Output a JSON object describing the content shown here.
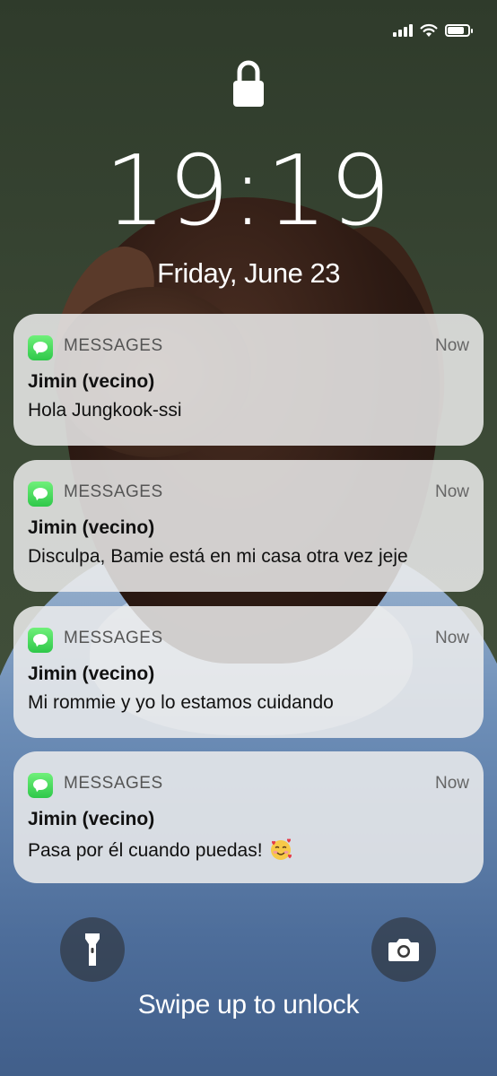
{
  "status_bar": {
    "signal_icon": "cellular-signal-icon",
    "wifi_icon": "wifi-icon",
    "battery_icon": "battery-icon",
    "battery_level": 0.85
  },
  "lock_screen": {
    "lock_icon": "padlock-icon",
    "time": "19:19",
    "date": "Friday, June 23"
  },
  "notifications": [
    {
      "app": "MESSAGES",
      "time": "Now",
      "sender": "Jimin (vecino)",
      "message": "Hola Jungkook-ssi"
    },
    {
      "app": "MESSAGES",
      "time": "Now",
      "sender": "Jimin (vecino)",
      "message": "Disculpa, Bamie está en mi casa otra vez jeje"
    },
    {
      "app": "MESSAGES",
      "time": "Now",
      "sender": "Jimin (vecino)",
      "message": "Mi rommie y yo lo estamos cuidando"
    },
    {
      "app": "MESSAGES",
      "time": "Now",
      "sender": "Jimin (vecino)",
      "message": "Pasa por él cuando puedas!",
      "emoji": "smiling-face-with-hearts-icon"
    }
  ],
  "bottom": {
    "flashlight_icon": "flashlight-icon",
    "camera_icon": "camera-icon",
    "swipe_text": "Swipe up to unlock"
  },
  "colors": {
    "messages_green": "#34C759",
    "notification_bg": "#ECECEC"
  }
}
